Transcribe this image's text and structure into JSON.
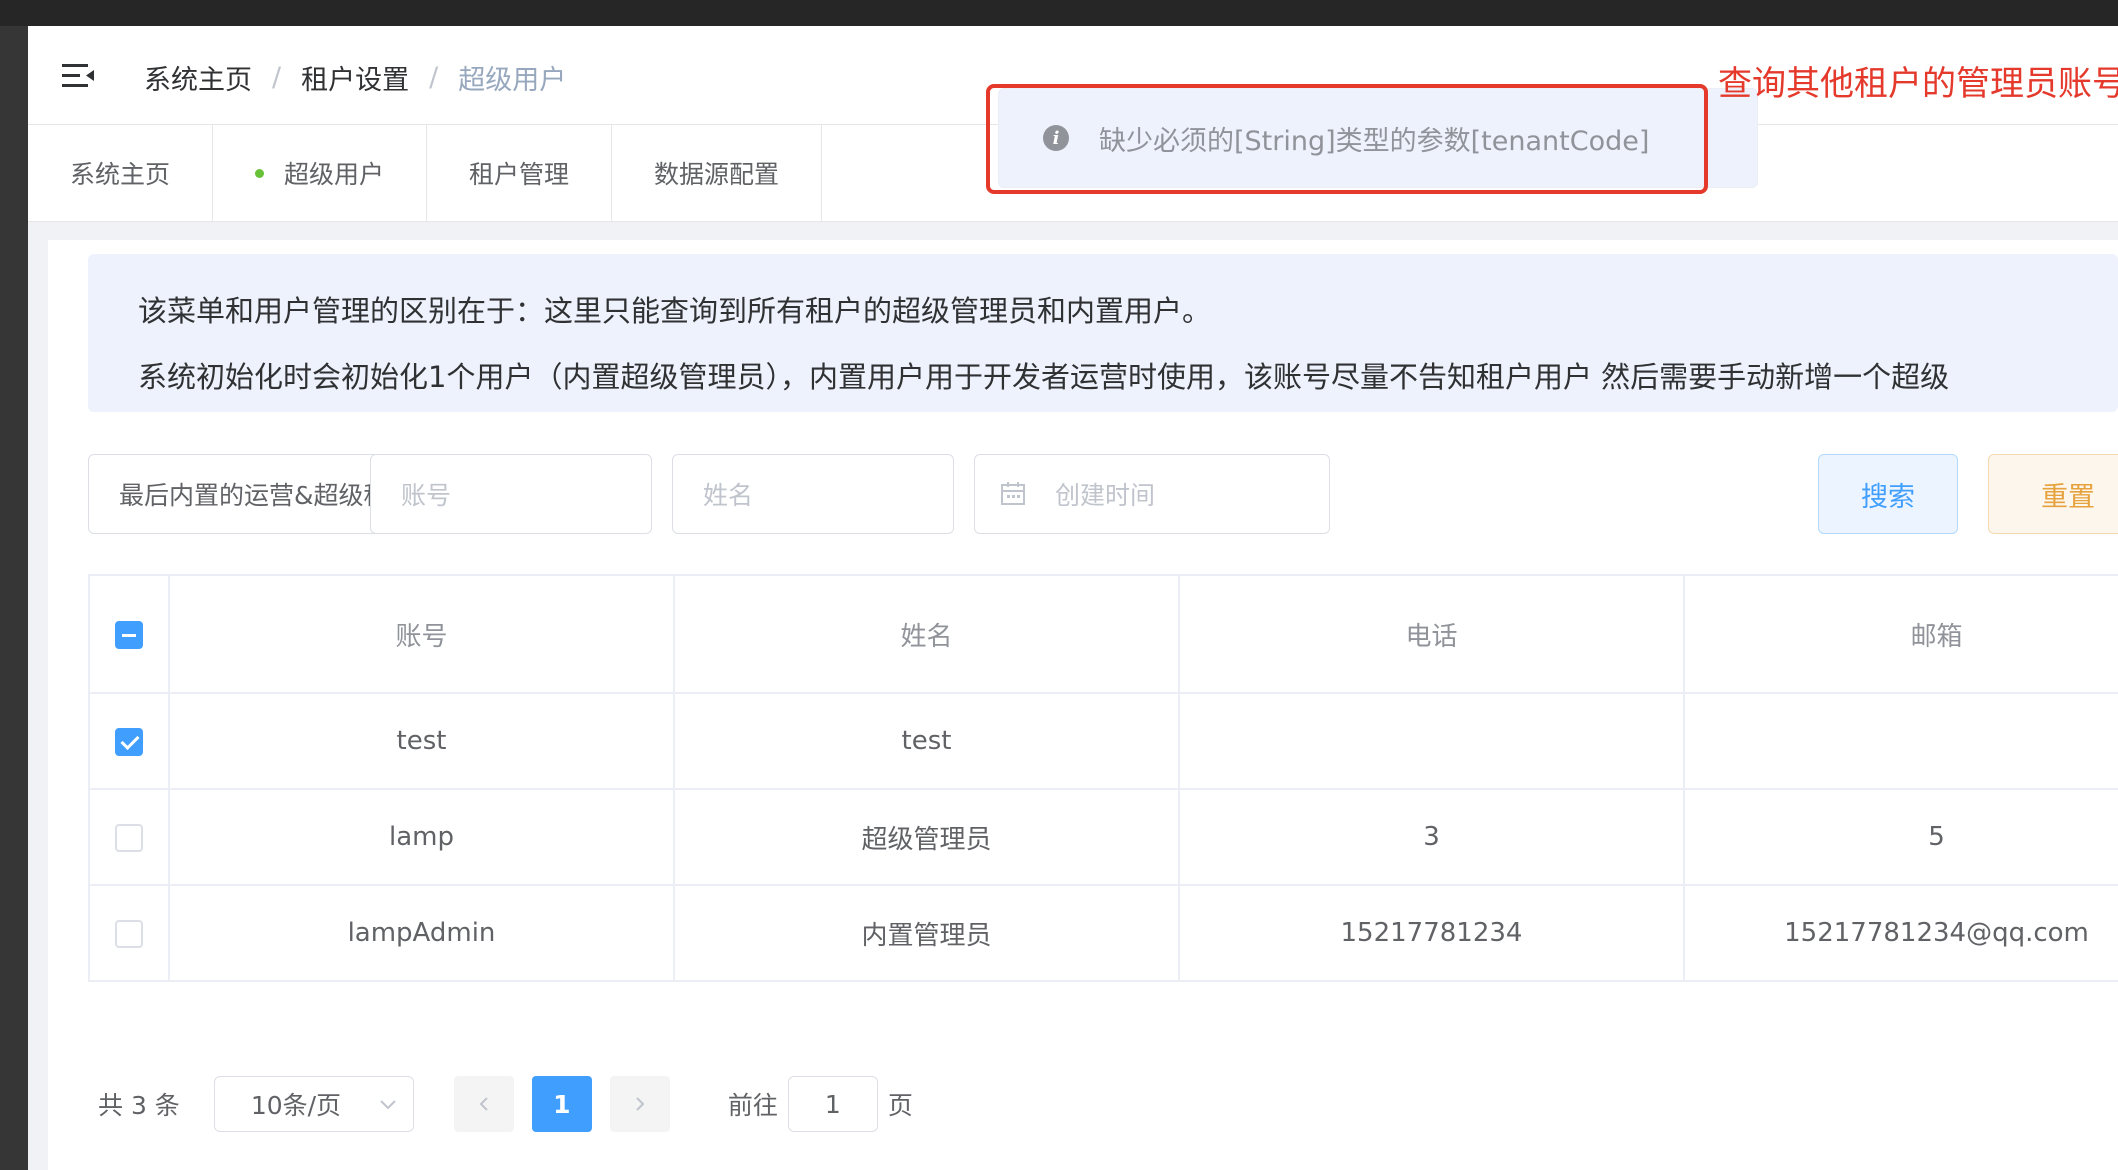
{
  "breadcrumb": {
    "home": "系统主页",
    "tenant_settings": "租户设置",
    "current": "超级用户",
    "separator": "/"
  },
  "tags": [
    "系统主页",
    "超级用户",
    "租户管理",
    "数据源配置"
  ],
  "alert": {
    "line1": "该菜单和用户管理的区别在于：这里只能查询到所有租户的超级管理员和内置用户。",
    "line2": "系统初始化时会初始化1个用户（内置超级管理员），内置用户用于开发者运营时使用，该账号尽量不告知租户用户 然后需要手动新增一个超级"
  },
  "search": {
    "tenant_select": "最后内置的运营&超级租",
    "account_placeholder": "账号",
    "name_placeholder": "姓名",
    "date_placeholder": "创建时间",
    "search_label": "搜索",
    "reset_label": "重置"
  },
  "table": {
    "headers": [
      "账号",
      "姓名",
      "电话",
      "邮箱"
    ],
    "rows": [
      {
        "account": "test",
        "name": "test",
        "phone": "",
        "email": ""
      },
      {
        "account": "lamp",
        "name": "超级管理员",
        "phone": "3",
        "email": "5"
      },
      {
        "account": "lampAdmin",
        "name": "内置管理员",
        "phone": "15217781234",
        "email": "15217781234@qq.com"
      }
    ]
  },
  "pagination": {
    "total": "共 3 条",
    "page_size": "10条/页",
    "current_page": "1",
    "goto": "前往",
    "jump_value": "1",
    "page_suffix": "页"
  },
  "toast": {
    "message": "缺少必须的[String]类型的参数[tenantCode]",
    "icon": "i"
  },
  "annotation": "查询其他租户的管理员账号",
  "colors": {
    "primary": "#409eff",
    "warning": "#e6a23c",
    "annotation_red": "#e4392b",
    "tag_dot": "#67c23a"
  }
}
